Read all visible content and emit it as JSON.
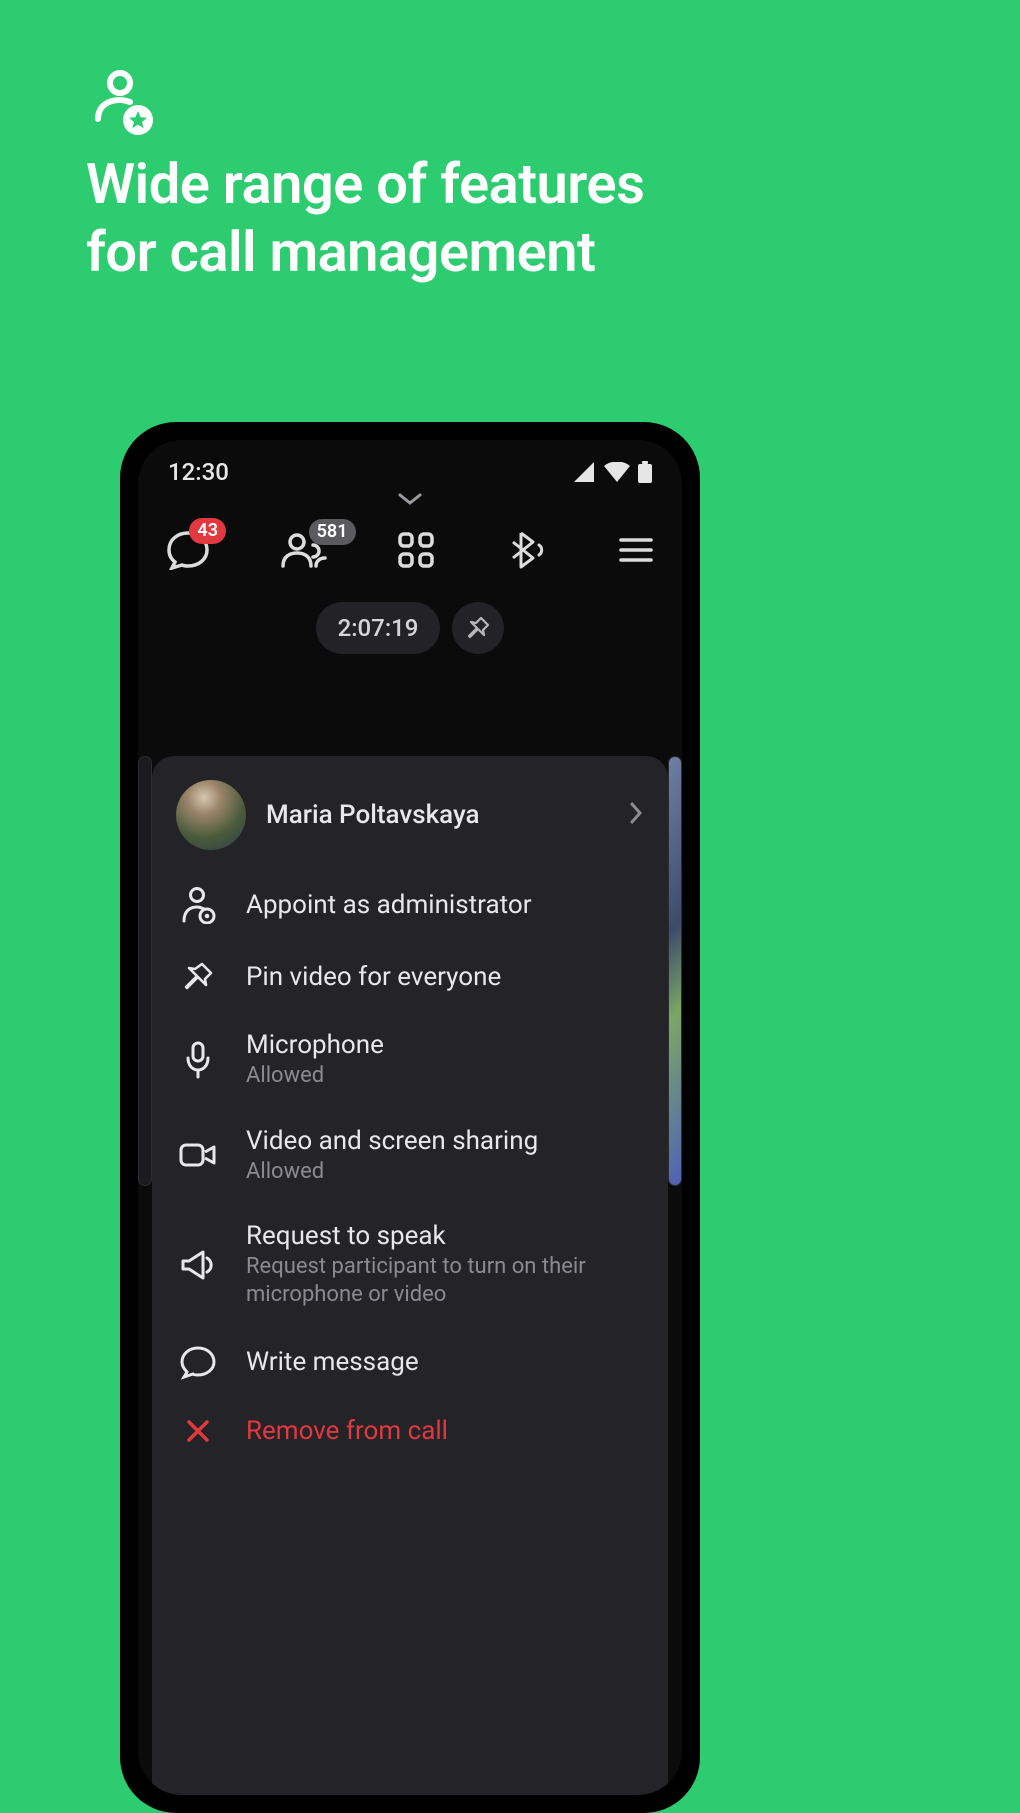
{
  "promo": {
    "headline": "Wide range of features\nfor call management"
  },
  "statusbar": {
    "time": "12:30"
  },
  "topbar": {
    "chat_badge": "43",
    "participants_badge": "581"
  },
  "call": {
    "duration": "2:07:19"
  },
  "sheet": {
    "user_name": "Maria Poltavskaya",
    "items": {
      "admin": {
        "title": "Appoint as administrator"
      },
      "pin": {
        "title": "Pin video for everyone"
      },
      "microphone": {
        "title": "Microphone",
        "sub": "Allowed"
      },
      "video": {
        "title": "Video and screen sharing",
        "sub": "Allowed"
      },
      "request": {
        "title": "Request to speak",
        "sub": "Request participant to turn on their microphone or video"
      },
      "message": {
        "title": "Write message"
      },
      "remove": {
        "title": "Remove from call"
      }
    }
  }
}
